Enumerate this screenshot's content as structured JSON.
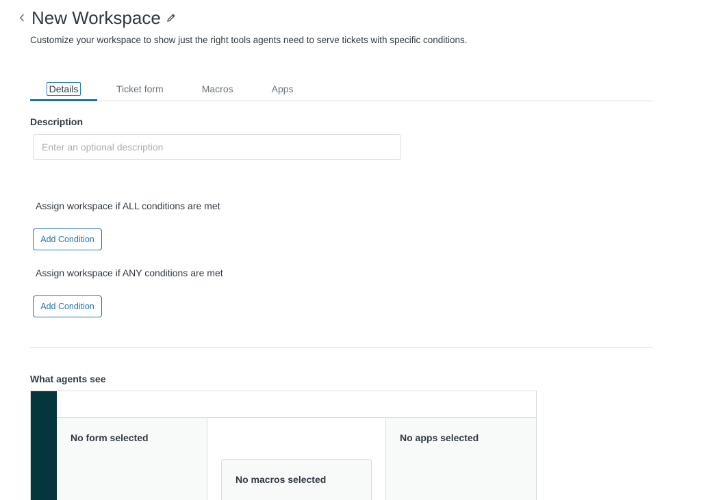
{
  "header": {
    "title": "New Workspace",
    "subtitle": "Customize your workspace to show just the right tools agents need to serve tickets with specific conditions."
  },
  "tabs": [
    {
      "label": "Details",
      "active": true
    },
    {
      "label": "Ticket form",
      "active": false
    },
    {
      "label": "Macros",
      "active": false
    },
    {
      "label": "Apps",
      "active": false
    }
  ],
  "description": {
    "label": "Description",
    "value": "",
    "placeholder": "Enter an optional description"
  },
  "conditions": {
    "all_label": "Assign workspace if ALL conditions are met",
    "any_label": "Assign workspace if ANY conditions are met",
    "add_button_label": "Add Condition"
  },
  "preview": {
    "label": "What agents see",
    "form_text": "No form selected",
    "macros_text": "No macros selected",
    "apps_text": "No apps selected"
  },
  "icons": {
    "back": "chevron-left-icon",
    "edit": "pencil-icon"
  },
  "colors": {
    "accent": "#1f73b7",
    "sidebar": "#03363d",
    "text": "#2f3941",
    "muted": "#68737d",
    "border": "#d8dcde"
  }
}
